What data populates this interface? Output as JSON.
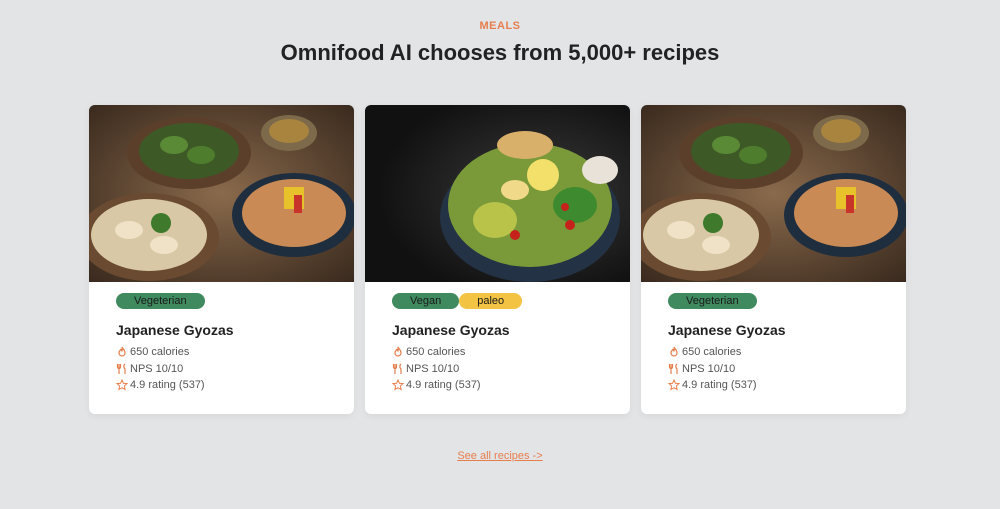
{
  "section": {
    "subheading": "MEALS",
    "heading": "Omnifood AI chooses from 5,000+ recipes",
    "link_label": "See all recipes ->"
  },
  "colors": {
    "accent": "#e67e4d",
    "vegetarian_tag": "#3f8a5f",
    "vegan_tag": "#3f8a5f",
    "paleo_tag": "#f3c343"
  },
  "cards": [
    {
      "image": "japanese-gyozas-photo",
      "tags": [
        "Vegeterian"
      ],
      "title": "Japanese Gyozas",
      "calories": "650 calories",
      "nps": "NPS 10/10",
      "rating": "4.9 rating (537)"
    },
    {
      "image": "avocado-salad-bowl-photo",
      "tags": [
        "Vegan",
        "paleo"
      ],
      "title": "Japanese Gyozas",
      "calories": "650 calories",
      "nps": "NPS 10/10",
      "rating": "4.9 rating (537)"
    },
    {
      "image": "japanese-gyozas-photo",
      "tags": [
        "Vegeterian"
      ],
      "title": "Japanese Gyozas",
      "calories": "650 calories",
      "nps": "NPS 10/10",
      "rating": "4.9 rating (537)"
    }
  ],
  "icons": {
    "calories": "flame-icon",
    "nps": "utensils-icon",
    "rating": "star-icon"
  }
}
